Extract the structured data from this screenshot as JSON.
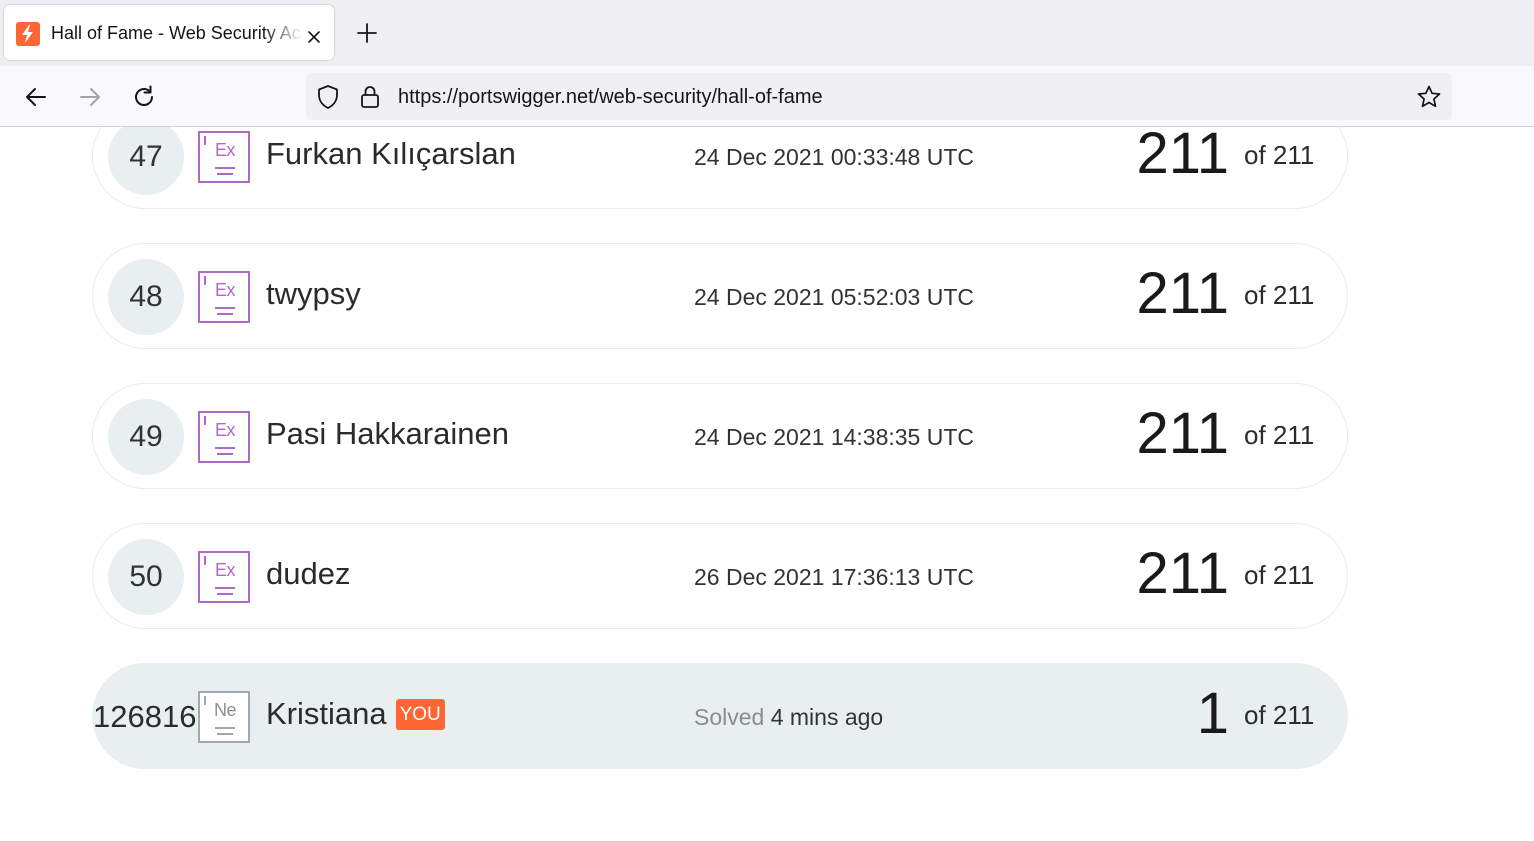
{
  "browser": {
    "tab_title": "Hall of Fame - Web Security Academy",
    "url": "https://portswigger.net/web-security/hall-of-fame",
    "accent": "#ff6633"
  },
  "icons": [
    "portswigger-favicon",
    "close-icon",
    "plus-icon",
    "back-arrow-icon",
    "forward-arrow-icon",
    "reload-icon",
    "shield-icon",
    "lock-icon",
    "star-icon"
  ],
  "leaderboard": {
    "rows": [
      {
        "rank": "47",
        "level": "Ex",
        "name": "Furkan Kılıçarslan",
        "date": "24 Dec 2021 00:33:48 UTC",
        "solved": "211",
        "of": "of 211"
      },
      {
        "rank": "48",
        "level": "Ex",
        "name": "twypsy",
        "date": "24 Dec 2021 05:52:03 UTC",
        "solved": "211",
        "of": "of 211"
      },
      {
        "rank": "49",
        "level": "Ex",
        "name": "Pasi Hakkarainen",
        "date": "24 Dec 2021 14:38:35 UTC",
        "solved": "211",
        "of": "of 211"
      },
      {
        "rank": "50",
        "level": "Ex",
        "name": "dudez",
        "date": "26 Dec 2021 17:36:13 UTC",
        "solved": "211",
        "of": "of 211"
      }
    ],
    "you_row": {
      "rank": "126816",
      "level": "Ne",
      "name": "Kristiana",
      "you_badge": "YOU",
      "solved_label": "Solved",
      "solved_when": "4 mins ago",
      "solved": "1",
      "of": "of 211"
    }
  }
}
